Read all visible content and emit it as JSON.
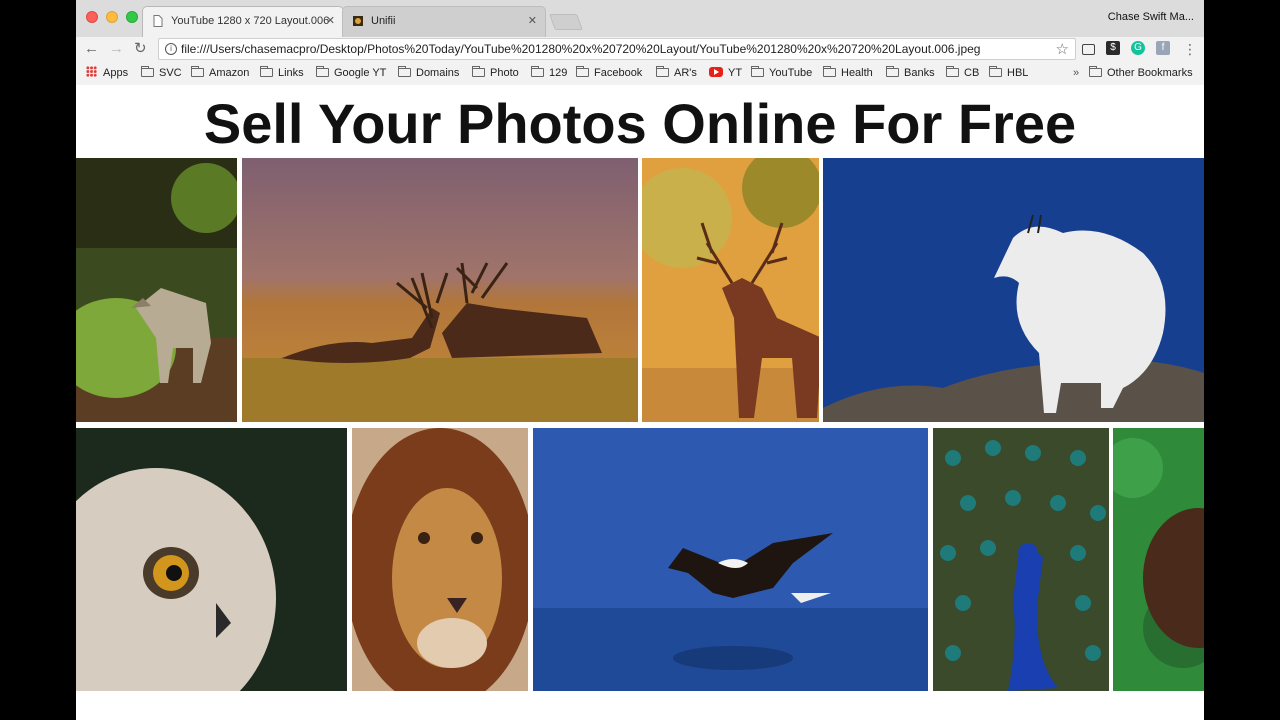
{
  "browser": {
    "tabs": [
      {
        "title": "YouTube 1280 x 720 Layout.006",
        "active": true
      },
      {
        "title": "Unifii",
        "active": false
      }
    ],
    "profile_name": "Chase Swift Ma...",
    "url": "file:///Users/chasemacpro/Desktop/Photos%20Today/YouTube%201280%20x%20720%20Layout/YouTube%201280%20x%20720%20Layout.006.jpeg",
    "bookmarks": [
      {
        "label": "Apps",
        "icon": "apps-grid-icon"
      },
      {
        "label": "SVC",
        "icon": "folder-icon"
      },
      {
        "label": "Amazon",
        "icon": "folder-icon"
      },
      {
        "label": "Links",
        "icon": "folder-icon"
      },
      {
        "label": "Google YT",
        "icon": "folder-icon"
      },
      {
        "label": "Domains",
        "icon": "folder-icon"
      },
      {
        "label": "Photo",
        "icon": "folder-icon"
      },
      {
        "label": "129",
        "icon": "folder-icon"
      },
      {
        "label": "Facebook",
        "icon": "folder-icon"
      },
      {
        "label": "AR's",
        "icon": "folder-icon"
      },
      {
        "label": "YT",
        "icon": "youtube-icon"
      },
      {
        "label": "YouTube",
        "icon": "folder-icon"
      },
      {
        "label": "Health",
        "icon": "folder-icon"
      },
      {
        "label": "Banks",
        "icon": "folder-icon"
      },
      {
        "label": "CB",
        "icon": "folder-icon"
      },
      {
        "label": "HBL",
        "icon": "folder-icon"
      }
    ],
    "bookmarks_overflow": "»",
    "other_bookmarks": "Other Bookmarks",
    "colors": {
      "accent_red": "#e62117",
      "tabstrip": "#dcdcdc",
      "toolbar": "#f2f2f2"
    }
  },
  "page": {
    "headline": "Sell Your Photos Online For Free",
    "photos_row1": [
      "wolf",
      "two elk",
      "deer stag",
      "mountain goat"
    ],
    "photos_row2": [
      "owl",
      "lion",
      "eagle over water",
      "peacock",
      "bird on green"
    ]
  }
}
